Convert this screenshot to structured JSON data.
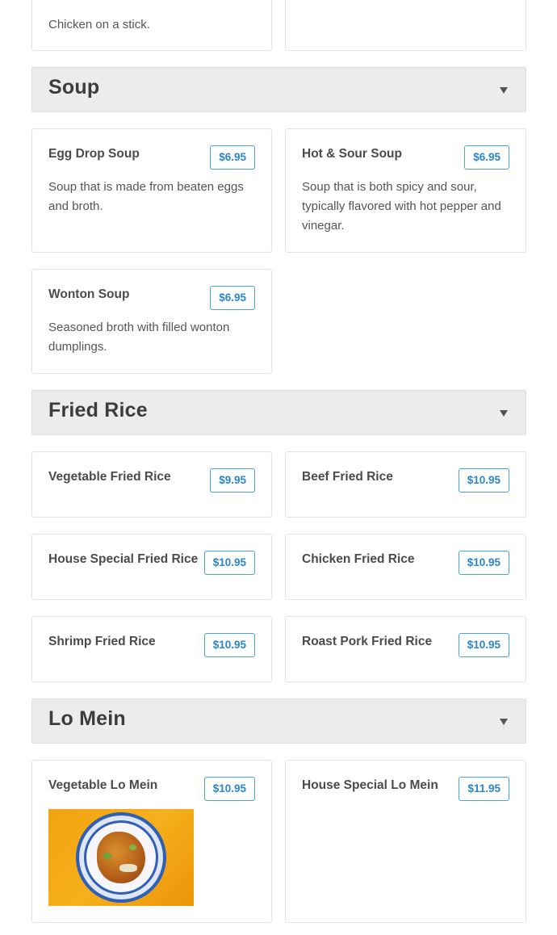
{
  "top_partial": {
    "left_desc": "Chicken on a stick."
  },
  "sections": {
    "soup": {
      "title": "Soup",
      "items": [
        {
          "name": "Egg Drop Soup",
          "price": "$6.95",
          "desc": "Soup that is made from beaten eggs and broth."
        },
        {
          "name": "Hot & Sour Soup",
          "price": "$6.95",
          "desc": "Soup that is both spicy and sour, typically flavored with hot pepper and vinegar."
        },
        {
          "name": "Wonton Soup",
          "price": "$6.95",
          "desc": "Seasoned broth with filled wonton dumplings."
        }
      ]
    },
    "fried_rice": {
      "title": "Fried Rice",
      "items": [
        {
          "name": "Vegetable Fried Rice",
          "price": "$9.95"
        },
        {
          "name": "Beef Fried Rice",
          "price": "$10.95"
        },
        {
          "name": "House Special Fried Rice",
          "price": "$10.95"
        },
        {
          "name": "Chicken Fried Rice",
          "price": "$10.95"
        },
        {
          "name": "Shrimp Fried Rice",
          "price": "$10.95"
        },
        {
          "name": "Roast Pork Fried Rice",
          "price": "$10.95"
        }
      ]
    },
    "lo_mein": {
      "title": "Lo Mein",
      "items": [
        {
          "name": "Vegetable Lo Mein",
          "price": "$10.95",
          "image": "lo-mein-photo"
        },
        {
          "name": "House Special Lo Mein",
          "price": "$11.95"
        }
      ]
    }
  },
  "icons": {
    "collapse": "chevron-down-icon"
  },
  "colors": {
    "price_border": "#4aa3df",
    "price_text": "#2a86c8",
    "section_bg": "#ececec"
  }
}
